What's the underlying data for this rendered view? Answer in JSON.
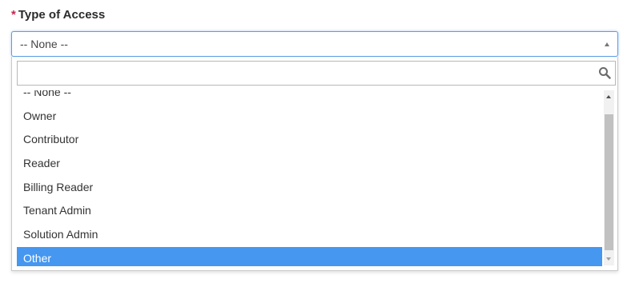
{
  "field": {
    "required_marker": "*",
    "label": "Type of Access"
  },
  "select": {
    "value": "-- None --"
  },
  "search": {
    "placeholder": "",
    "value": ""
  },
  "options": [
    {
      "label": "-- None --"
    },
    {
      "label": "Owner"
    },
    {
      "label": "Contributor"
    },
    {
      "label": "Reader"
    },
    {
      "label": "Billing Reader"
    },
    {
      "label": "Tenant Admin"
    },
    {
      "label": "Solution Admin"
    },
    {
      "label": "Other",
      "selected": true
    }
  ],
  "colors": {
    "accent": "#4597f0",
    "required": "#c7254e",
    "focus_border": "#5a9ee6"
  },
  "icons": {
    "search": "search-icon",
    "select_arrow": "caret-up-icon"
  }
}
